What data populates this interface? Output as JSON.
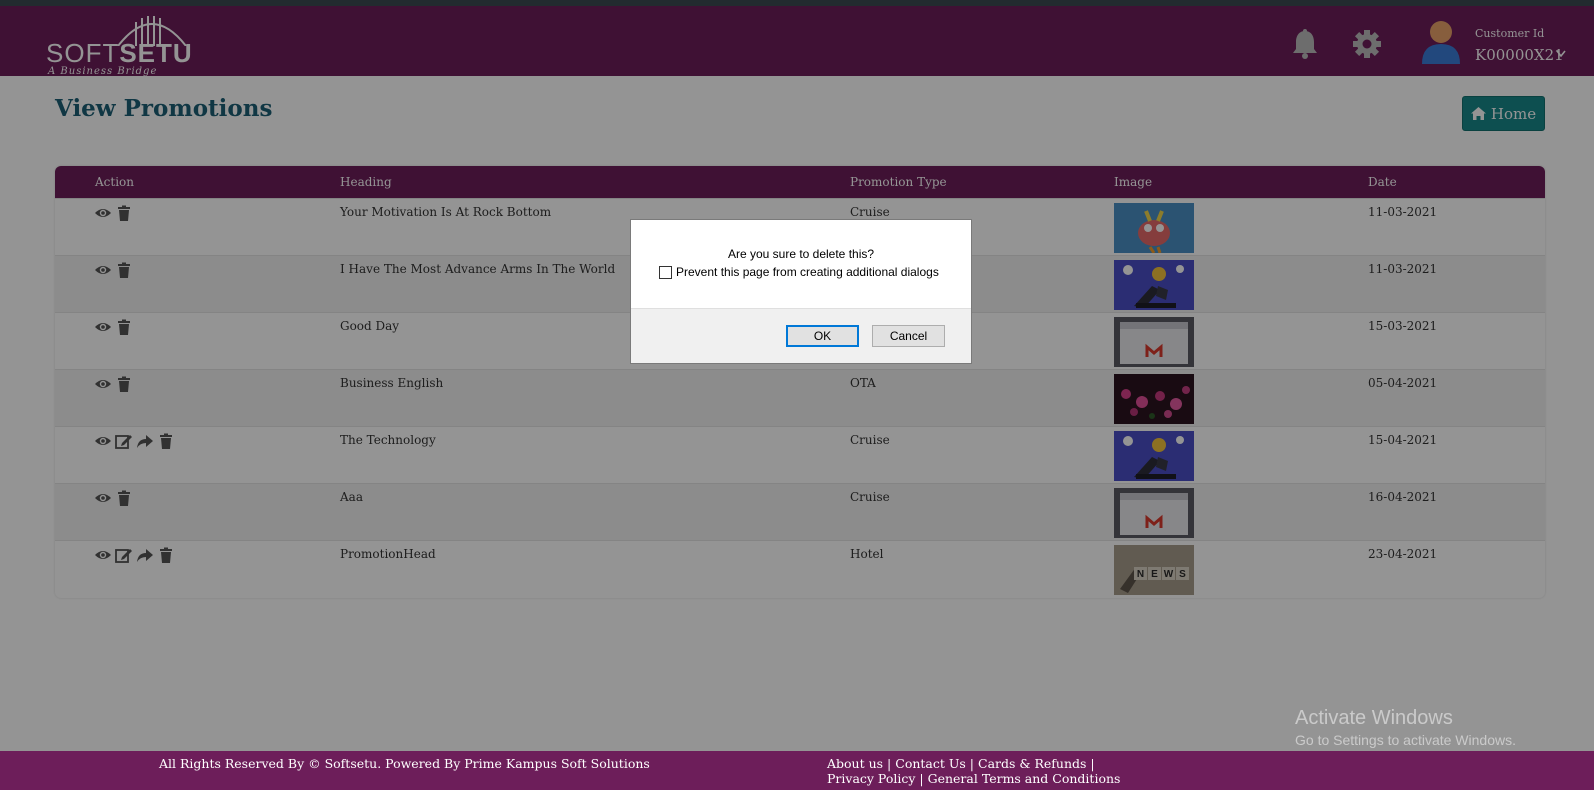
{
  "header": {
    "logo_text_light": "SOFT",
    "logo_text_bold": "SETU",
    "logo_tagline": "A Business Bridge",
    "notifications_icon": "bell-icon",
    "settings_icon": "gear-icon",
    "customer_label": "Customer Id",
    "customer_id": "K00000X21"
  },
  "page": {
    "title": "View Promotions",
    "home_label": "Home"
  },
  "table": {
    "columns": [
      "Action",
      "Heading",
      "Promotion Type",
      "Image",
      "Date"
    ],
    "rows": [
      {
        "heading": "Your Motivation Is At Rock Bottom",
        "type": "Cruise",
        "date": "11-03-2021",
        "image": "cartoon-bird",
        "actions": [
          "view",
          "delete"
        ]
      },
      {
        "heading": "I Have The Most Advance Arms In The World",
        "type": "",
        "date": "11-03-2021",
        "image": "robot-arm",
        "actions": [
          "view",
          "delete"
        ]
      },
      {
        "heading": "Good Day",
        "type": "",
        "date": "15-03-2021",
        "image": "gmail",
        "actions": [
          "view",
          "delete"
        ]
      },
      {
        "heading": "Business English",
        "type": "OTA",
        "date": "05-04-2021",
        "image": "pink-flowers",
        "actions": [
          "view",
          "delete"
        ]
      },
      {
        "heading": "The Technology",
        "type": "Cruise",
        "date": "15-04-2021",
        "image": "robot-arm",
        "actions": [
          "view",
          "edit",
          "share",
          "delete"
        ]
      },
      {
        "heading": "Aaa",
        "type": "Cruise",
        "date": "16-04-2021",
        "image": "gmail",
        "actions": [
          "view",
          "delete"
        ]
      },
      {
        "heading": "PromotionHead",
        "type": "Hotel",
        "date": "23-04-2021",
        "image": "news-blocks",
        "actions": [
          "view",
          "edit",
          "share",
          "delete"
        ]
      }
    ],
    "news_text": "NEWS"
  },
  "dialog": {
    "message": "Are you sure to delete this?",
    "checkbox_label": "Prevent this page from creating additional dialogs",
    "ok_label": "OK",
    "cancel_label": "Cancel"
  },
  "footer": {
    "copyright": "All Rights Reserved By © Softsetu. Powered By Prime Kampus Soft Solutions",
    "links": [
      "About us",
      "Contact Us",
      "Cards & Refunds",
      "Privacy Policy",
      "General Terms and Conditions"
    ]
  },
  "watermark": {
    "line1": "Activate Windows",
    "line2": "Go to Settings to activate Windows."
  },
  "colors": {
    "brand": "#6d1e5a",
    "title": "#1d5f75",
    "home_button": "#17898b"
  }
}
